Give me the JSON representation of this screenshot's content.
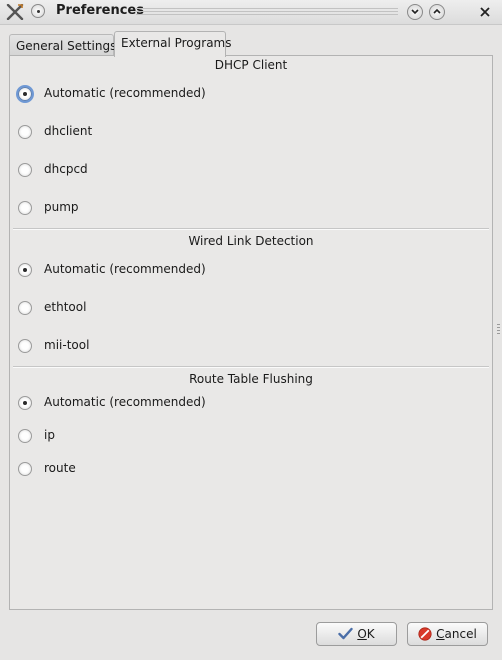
{
  "window": {
    "title": "Preferences",
    "icons": {
      "app": "x-tools-icon",
      "menu": "window-menu-icon",
      "minimize": "chevron-down-icon",
      "maximize": "chevron-up-icon",
      "close": "close-icon"
    }
  },
  "tabs": [
    {
      "label": "General Settings",
      "active": false
    },
    {
      "label": "External Programs",
      "active": true
    }
  ],
  "sections": [
    {
      "title": "DHCP Client",
      "options": [
        {
          "label": "Automatic (recommended)",
          "checked": true,
          "focused": true
        },
        {
          "label": "dhclient",
          "checked": false
        },
        {
          "label": "dhcpcd",
          "checked": false
        },
        {
          "label": "pump",
          "checked": false
        }
      ]
    },
    {
      "title": "Wired Link Detection",
      "options": [
        {
          "label": "Automatic (recommended)",
          "checked": true
        },
        {
          "label": "ethtool",
          "checked": false
        },
        {
          "label": "mii-tool",
          "checked": false
        }
      ]
    },
    {
      "title": "Route Table Flushing",
      "options": [
        {
          "label": "Automatic (recommended)",
          "checked": true
        },
        {
          "label": "ip",
          "checked": false
        },
        {
          "label": "route",
          "checked": false
        }
      ]
    }
  ],
  "buttons": {
    "ok": {
      "label_mnemonic": "O",
      "label_rest": "K",
      "icon": "checkmark-icon"
    },
    "cancel": {
      "label_mnemonic": "C",
      "label_rest": "ancel",
      "icon": "cancel-icon"
    }
  },
  "colors": {
    "focus_ring": "#6e98d5",
    "cancel_icon": "#d93a2b",
    "ok_icon": "#4a6ea8"
  }
}
